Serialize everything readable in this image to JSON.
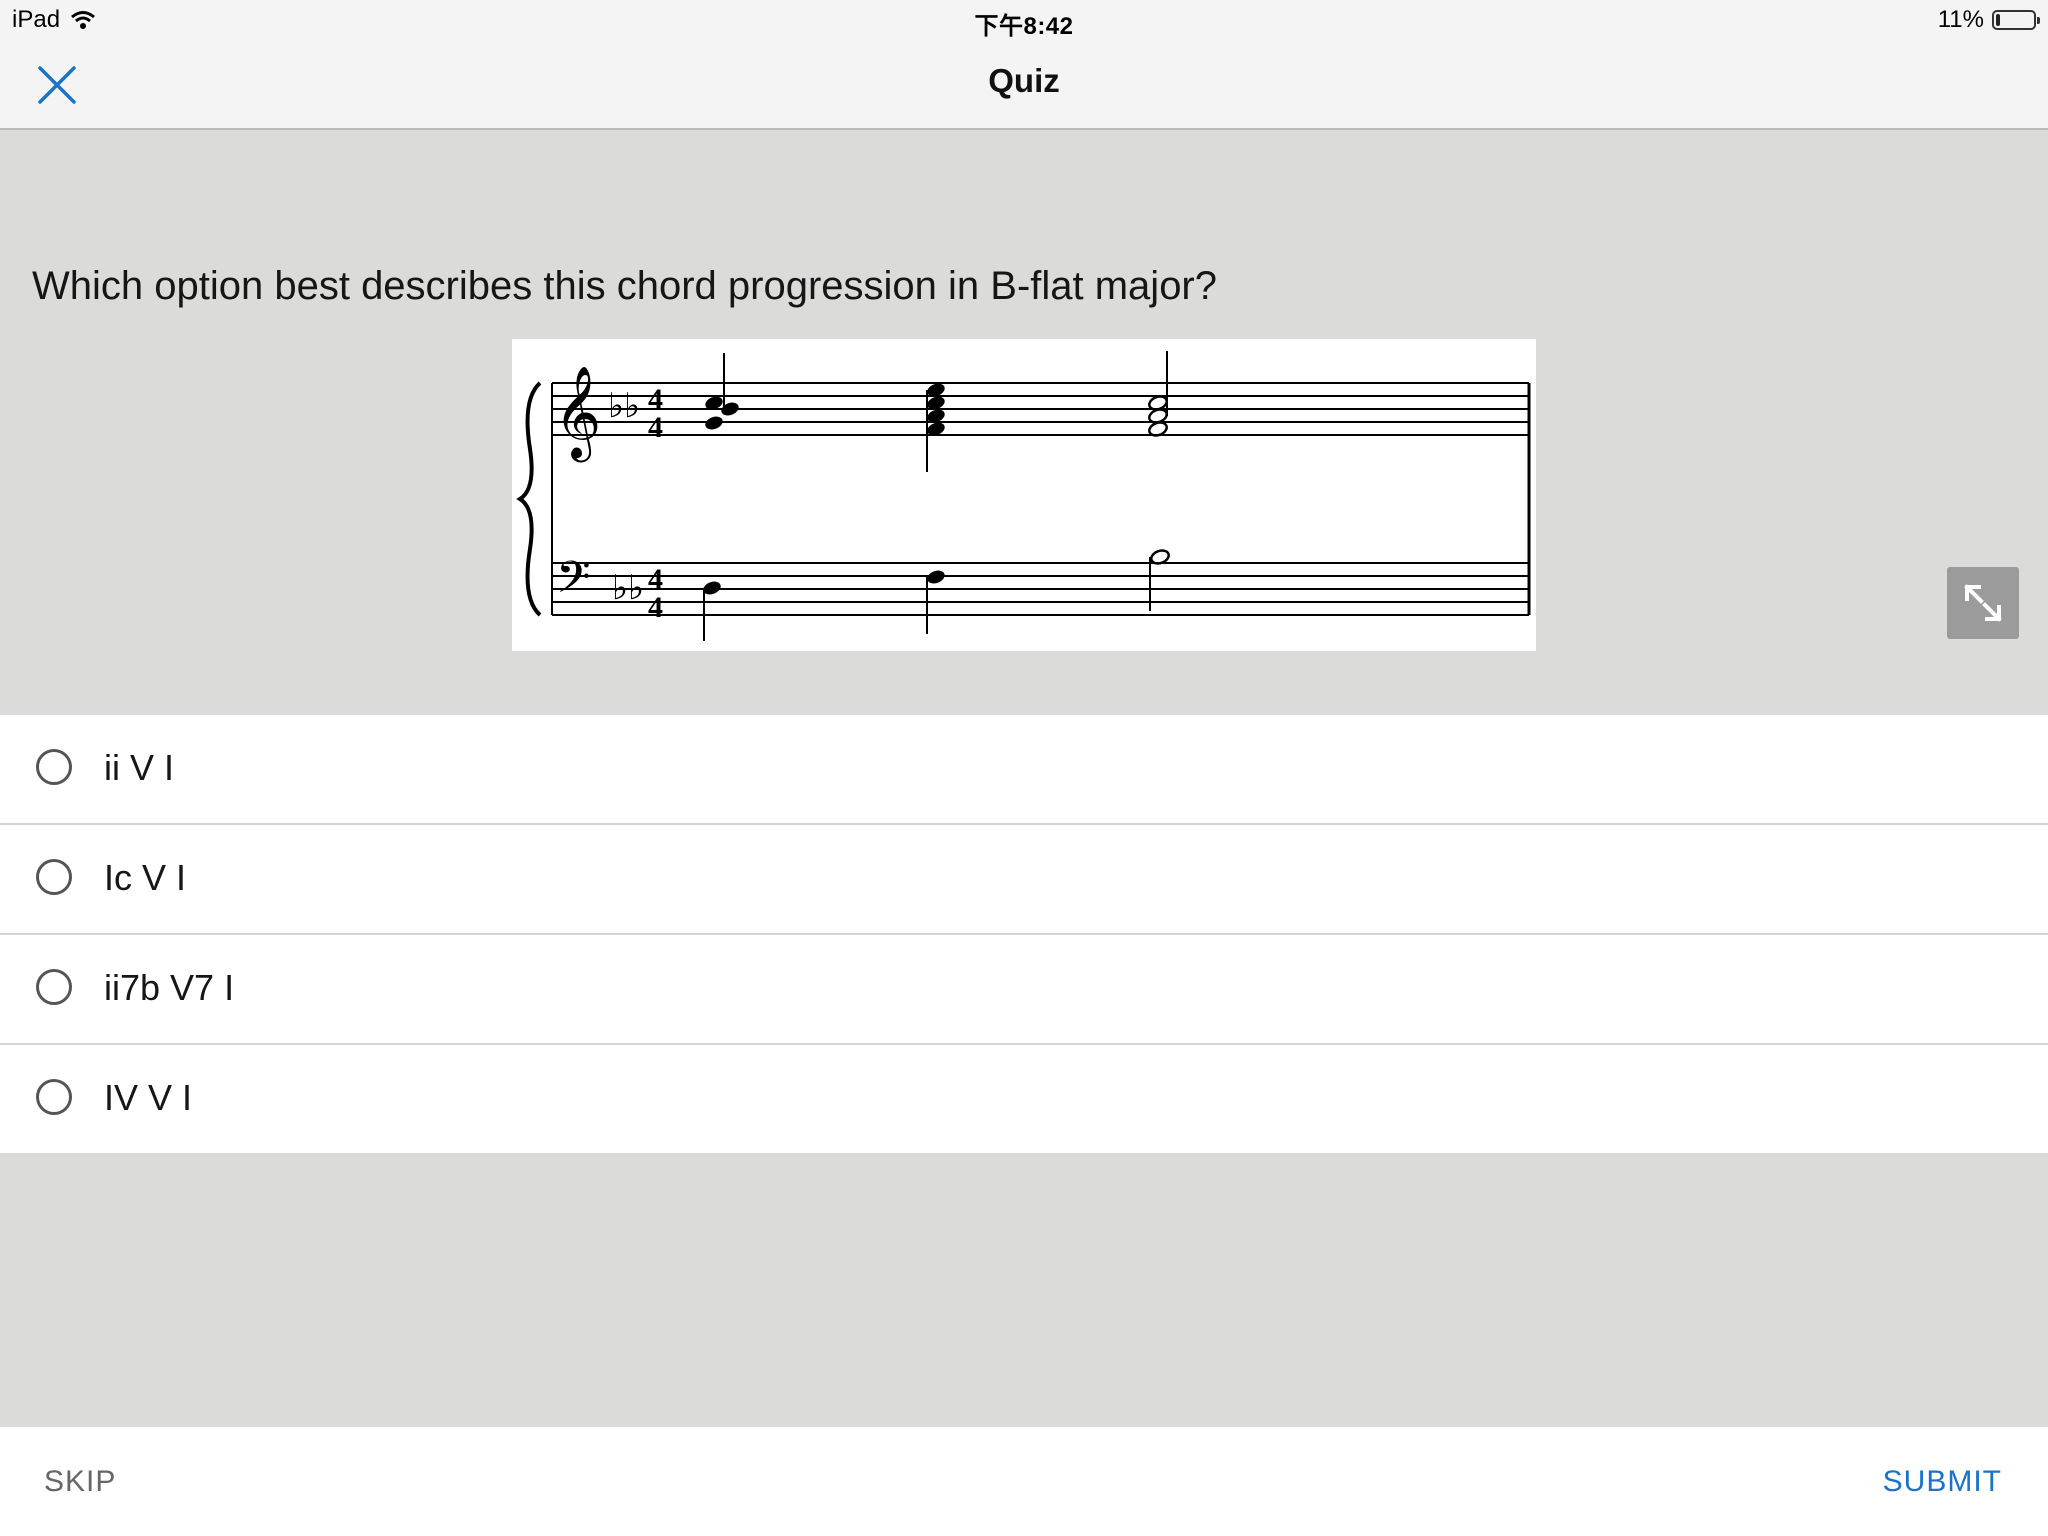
{
  "status_bar": {
    "device": "iPad",
    "time": "下午8:42",
    "battery": "11%",
    "battery_level": 0.11
  },
  "nav": {
    "title": "Quiz"
  },
  "question": {
    "text": "Which option best describes this chord progression in B-flat major?"
  },
  "options": [
    {
      "label": "ii V I"
    },
    {
      "label": "Ic V I"
    },
    {
      "label": "ii7b V7 I"
    },
    {
      "label": "IV V I"
    }
  ],
  "footer": {
    "skip_label": "SKIP",
    "submit_label": "SUBMIT"
  },
  "colors": {
    "accent": "#1a73c8",
    "background": "#dbdbda",
    "bar": "#f4f4f4"
  },
  "icons": [
    "wifi-icon",
    "battery-icon",
    "close-icon",
    "expand-icon"
  ]
}
